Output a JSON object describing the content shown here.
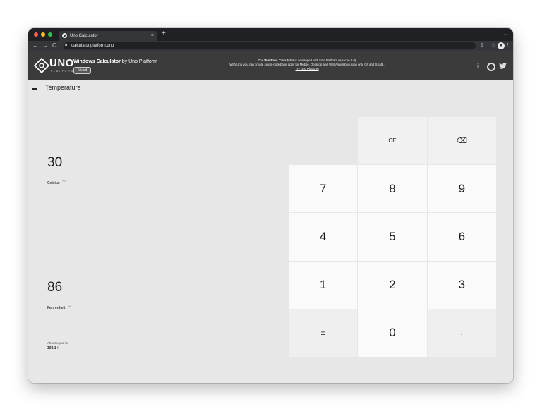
{
  "browser": {
    "tab_title": "Uno Calculator",
    "tab_close": "×",
    "new_tab": "+",
    "tab_menu": "⌄",
    "back": "←",
    "forward": "→",
    "reload": "C",
    "url": "calculator.platform.uno",
    "profile_initial": "⏺"
  },
  "header": {
    "logo_word": "UNO",
    "logo_sub": "PLATFORM",
    "app_title_bold": "Windows Calculator",
    "app_title_rest": " by Uno Platform",
    "badge": "Mixed",
    "banner_line1_pre": "The ",
    "banner_line1_bold": "Windows Calculator",
    "banner_line1_post": " is developed with Uno Platform (Apache 2.0)",
    "banner_line2": "With Uno you can create single-codebase apps for Mobile, Desktop and WebAssembly using only C# and XAML.",
    "banner_link": "Try Uno Platform",
    "info_icon": "i"
  },
  "app": {
    "mode": "Temperature",
    "input_value": "30",
    "input_unit": "Celsius",
    "output_value": "86",
    "output_unit": "Fahrenheit",
    "about_label": "About equal to",
    "about_value": "303.1",
    "about_unit": "K"
  },
  "keypad": [
    {
      "label": "",
      "name": "blank-key"
    },
    {
      "label": "CE",
      "name": "clear-entry-button"
    },
    {
      "label": "⌫",
      "name": "backspace-button"
    },
    {
      "label": "7",
      "name": "key-7"
    },
    {
      "label": "8",
      "name": "key-8"
    },
    {
      "label": "9",
      "name": "key-9"
    },
    {
      "label": "4",
      "name": "key-4"
    },
    {
      "label": "5",
      "name": "key-5"
    },
    {
      "label": "6",
      "name": "key-6"
    },
    {
      "label": "1",
      "name": "key-1"
    },
    {
      "label": "2",
      "name": "key-2"
    },
    {
      "label": "3",
      "name": "key-3"
    },
    {
      "label": "±",
      "name": "negate-button"
    },
    {
      "label": "0",
      "name": "key-0"
    },
    {
      "label": ".",
      "name": "decimal-button"
    }
  ],
  "colors": {
    "header_bg": "#3b3b3b",
    "app_bg": "#e7e7e7",
    "key_bg": "#fafafa",
    "traffic_red": "#ff5f57",
    "traffic_yellow": "#febc2e",
    "traffic_green": "#28c840"
  }
}
